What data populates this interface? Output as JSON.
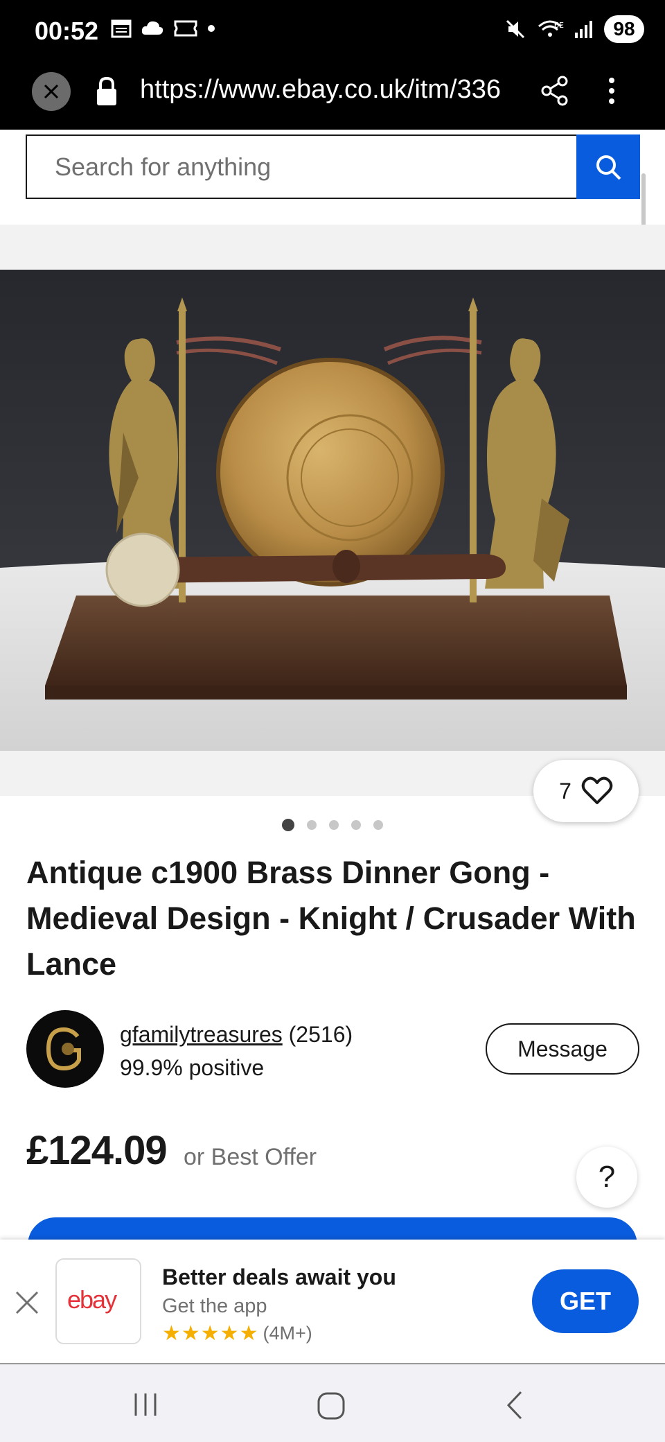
{
  "status_bar": {
    "time": "00:52",
    "battery": "98",
    "network": "6E"
  },
  "url_bar": {
    "url": "https://www.ebay.co.uk/itm/336"
  },
  "search": {
    "placeholder": "Search for anything"
  },
  "gallery": {
    "favorite_count": "7",
    "image_count": 5,
    "active_index": 0
  },
  "listing": {
    "title": "Antique c1900 Brass Dinner Gong - Medieval Design - Knight / Crusader With Lance",
    "price": "£124.09",
    "price_note": "or Best Offer"
  },
  "seller": {
    "name": "gfamilytreasures",
    "feedback_count": "(2516)",
    "positive": "99.9% positive",
    "message_label": "Message"
  },
  "help": {
    "label": "?"
  },
  "app_banner": {
    "logo_text": "ebay",
    "title": "Better deals await you",
    "subtitle": "Get the app",
    "stars": "★★★★★",
    "rating_count": "(4M+)",
    "get_label": "GET"
  },
  "colors": {
    "accent": "#0a5cde",
    "star": "#f5af02"
  }
}
